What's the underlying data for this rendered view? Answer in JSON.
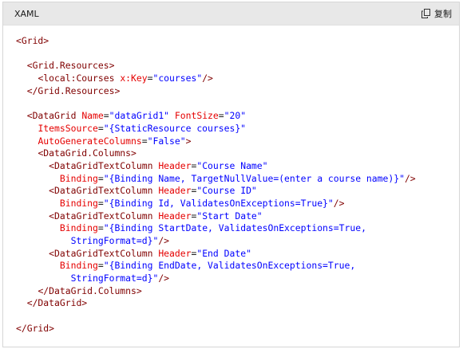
{
  "header": {
    "language": "XAML",
    "copy_label": "复制",
    "copy_icon": "copy-icon"
  },
  "colors": {
    "tag": "#800000",
    "attribute": "#e50000",
    "string": "#0000ff",
    "text": "#1e1e1e",
    "header_bg": "#e8e8e8"
  },
  "code_lines": [
    [
      {
        "t": "tag",
        "v": "<Grid>"
      }
    ],
    [],
    [
      {
        "t": "txt",
        "v": "  "
      },
      {
        "t": "tag",
        "v": "<Grid.Resources>"
      }
    ],
    [
      {
        "t": "txt",
        "v": "    "
      },
      {
        "t": "tag",
        "v": "<local:Courses"
      },
      {
        "t": "txt",
        "v": " "
      },
      {
        "t": "attr",
        "v": "x:Key"
      },
      {
        "t": "txt",
        "v": "="
      },
      {
        "t": "str",
        "v": "\"courses\""
      },
      {
        "t": "tag",
        "v": "/>"
      }
    ],
    [
      {
        "t": "txt",
        "v": "  "
      },
      {
        "t": "tag",
        "v": "</Grid.Resources>"
      }
    ],
    [],
    [
      {
        "t": "txt",
        "v": "  "
      },
      {
        "t": "tag",
        "v": "<DataGrid"
      },
      {
        "t": "txt",
        "v": " "
      },
      {
        "t": "attr",
        "v": "Name"
      },
      {
        "t": "txt",
        "v": "="
      },
      {
        "t": "str",
        "v": "\"dataGrid1\""
      },
      {
        "t": "txt",
        "v": " "
      },
      {
        "t": "attr",
        "v": "FontSize"
      },
      {
        "t": "txt",
        "v": "="
      },
      {
        "t": "str",
        "v": "\"20\""
      }
    ],
    [
      {
        "t": "txt",
        "v": "    "
      },
      {
        "t": "attr",
        "v": "ItemsSource"
      },
      {
        "t": "txt",
        "v": "="
      },
      {
        "t": "str",
        "v": "\"{StaticResource courses}\""
      }
    ],
    [
      {
        "t": "txt",
        "v": "    "
      },
      {
        "t": "attr",
        "v": "AutoGenerateColumns"
      },
      {
        "t": "txt",
        "v": "="
      },
      {
        "t": "str",
        "v": "\"False\""
      },
      {
        "t": "tag",
        "v": ">"
      }
    ],
    [
      {
        "t": "txt",
        "v": "    "
      },
      {
        "t": "tag",
        "v": "<DataGrid.Columns>"
      }
    ],
    [
      {
        "t": "txt",
        "v": "      "
      },
      {
        "t": "tag",
        "v": "<DataGridTextColumn"
      },
      {
        "t": "txt",
        "v": " "
      },
      {
        "t": "attr",
        "v": "Header"
      },
      {
        "t": "txt",
        "v": "="
      },
      {
        "t": "str",
        "v": "\"Course Name\""
      }
    ],
    [
      {
        "t": "txt",
        "v": "        "
      },
      {
        "t": "attr",
        "v": "Binding"
      },
      {
        "t": "txt",
        "v": "="
      },
      {
        "t": "str",
        "v": "\"{Binding Name, TargetNullValue=(enter a course name)}\""
      },
      {
        "t": "tag",
        "v": "/>"
      }
    ],
    [
      {
        "t": "txt",
        "v": "      "
      },
      {
        "t": "tag",
        "v": "<DataGridTextColumn"
      },
      {
        "t": "txt",
        "v": " "
      },
      {
        "t": "attr",
        "v": "Header"
      },
      {
        "t": "txt",
        "v": "="
      },
      {
        "t": "str",
        "v": "\"Course ID\""
      }
    ],
    [
      {
        "t": "txt",
        "v": "        "
      },
      {
        "t": "attr",
        "v": "Binding"
      },
      {
        "t": "txt",
        "v": "="
      },
      {
        "t": "str",
        "v": "\"{Binding Id, ValidatesOnExceptions=True}\""
      },
      {
        "t": "tag",
        "v": "/>"
      }
    ],
    [
      {
        "t": "txt",
        "v": "      "
      },
      {
        "t": "tag",
        "v": "<DataGridTextColumn"
      },
      {
        "t": "txt",
        "v": " "
      },
      {
        "t": "attr",
        "v": "Header"
      },
      {
        "t": "txt",
        "v": "="
      },
      {
        "t": "str",
        "v": "\"Start Date\""
      }
    ],
    [
      {
        "t": "txt",
        "v": "        "
      },
      {
        "t": "attr",
        "v": "Binding"
      },
      {
        "t": "txt",
        "v": "="
      },
      {
        "t": "str",
        "v": "\"{Binding StartDate, ValidatesOnExceptions=True,"
      }
    ],
    [
      {
        "t": "txt",
        "v": "          "
      },
      {
        "t": "str",
        "v": "StringFormat=d}\""
      },
      {
        "t": "tag",
        "v": "/>"
      }
    ],
    [
      {
        "t": "txt",
        "v": "      "
      },
      {
        "t": "tag",
        "v": "<DataGridTextColumn"
      },
      {
        "t": "txt",
        "v": " "
      },
      {
        "t": "attr",
        "v": "Header"
      },
      {
        "t": "txt",
        "v": "="
      },
      {
        "t": "str",
        "v": "\"End Date\""
      }
    ],
    [
      {
        "t": "txt",
        "v": "        "
      },
      {
        "t": "attr",
        "v": "Binding"
      },
      {
        "t": "txt",
        "v": "="
      },
      {
        "t": "str",
        "v": "\"{Binding EndDate, ValidatesOnExceptions=True,"
      }
    ],
    [
      {
        "t": "txt",
        "v": "          "
      },
      {
        "t": "str",
        "v": "StringFormat=d}\""
      },
      {
        "t": "tag",
        "v": "/>"
      }
    ],
    [
      {
        "t": "txt",
        "v": "    "
      },
      {
        "t": "tag",
        "v": "</DataGrid.Columns>"
      }
    ],
    [
      {
        "t": "txt",
        "v": "  "
      },
      {
        "t": "tag",
        "v": "</DataGrid>"
      }
    ],
    [],
    [
      {
        "t": "tag",
        "v": "</Grid>"
      }
    ]
  ]
}
